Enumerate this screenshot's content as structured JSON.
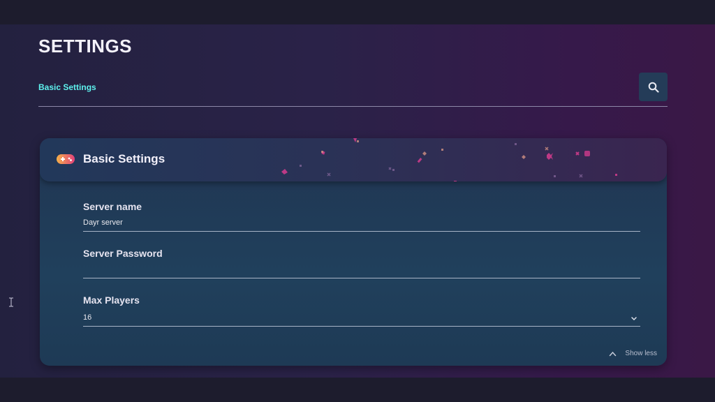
{
  "page": {
    "title": "SETTINGS"
  },
  "tabs": [
    {
      "label": "Basic Settings",
      "active": true
    }
  ],
  "search": {
    "icon": "search-icon"
  },
  "card": {
    "title": "Basic Settings",
    "icon": "gamepad-icon",
    "fields": {
      "server_name": {
        "label": "Server name",
        "value": "Dayr server"
      },
      "server_password": {
        "label": "Server Password",
        "value": ""
      },
      "max_players": {
        "label": "Max Players",
        "value": "16"
      }
    },
    "toggle": {
      "label": "Show less",
      "icon": "chevron-up-icon"
    }
  },
  "colors": {
    "accent": "#5ef2ee",
    "card_bg": "#20405c",
    "background_left": "#23213f",
    "background_right": "#3a1846",
    "confetti_pink": "#e0409a"
  }
}
